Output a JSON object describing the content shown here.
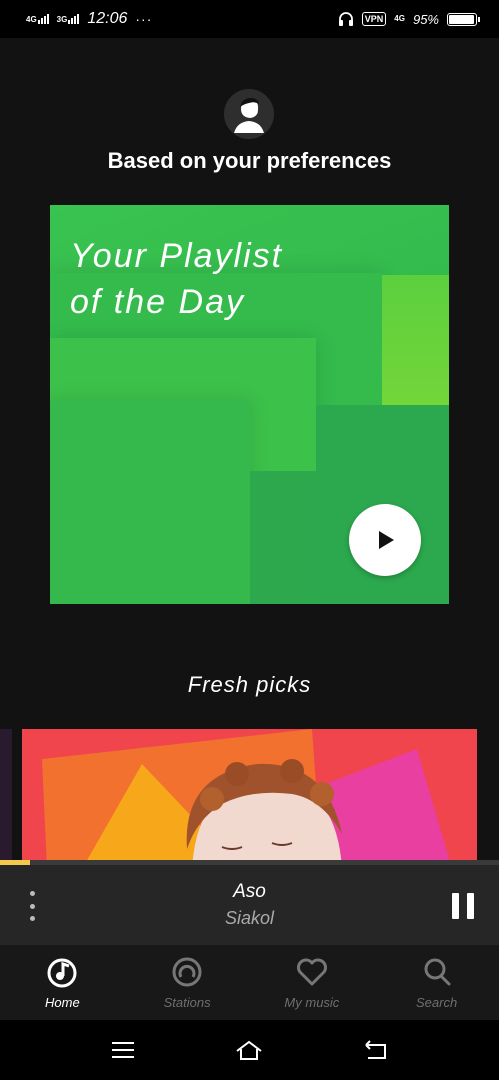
{
  "status_bar": {
    "net1": "4G",
    "net2": "3G",
    "time": "12:06",
    "more": "···",
    "vpn": "VPN",
    "net3": "4G",
    "battery": "95%",
    "battery_level": 0.95
  },
  "main": {
    "heading": "Based on your preferences",
    "playlist_card": {
      "title": "Your Playlist\nof the Day"
    },
    "fresh_section_title": "Fresh picks"
  },
  "player": {
    "progress": 0.06,
    "track_title": "Aso",
    "track_artist": "Siakol",
    "accent_color": "#f2c94c"
  },
  "bottom_nav": {
    "items": [
      {
        "label": "Home",
        "icon": "home-music-icon",
        "active": true
      },
      {
        "label": "Stations",
        "icon": "stations-icon",
        "active": false
      },
      {
        "label": "My music",
        "icon": "heart-icon",
        "active": false
      },
      {
        "label": "Search",
        "icon": "search-icon",
        "active": false
      }
    ]
  },
  "system_nav": {
    "icons": [
      "menu-icon",
      "home-icon",
      "back-icon"
    ]
  }
}
